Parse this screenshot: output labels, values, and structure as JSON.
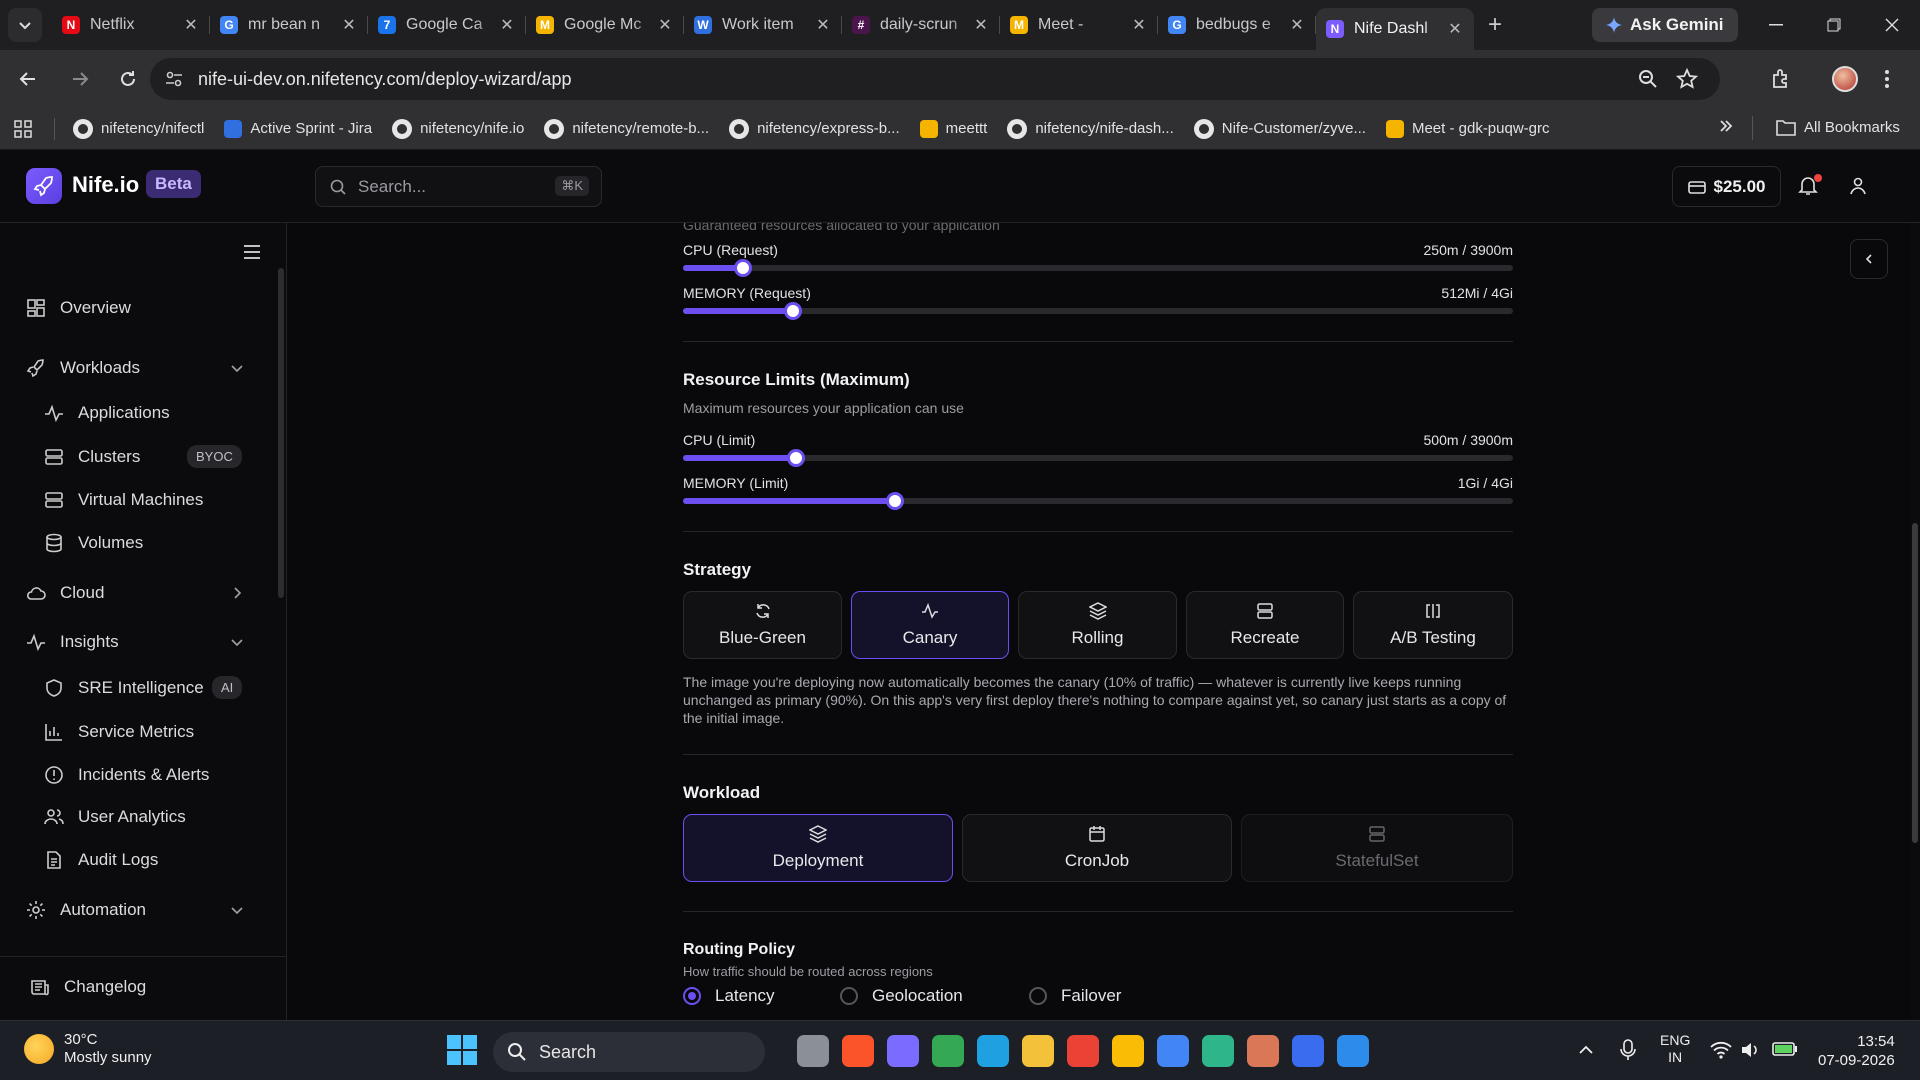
{
  "browser": {
    "tabs": [
      {
        "title": "Netflix",
        "favicon": "netflix-icon",
        "color": "#e50914",
        "glyph": "N"
      },
      {
        "title": "mr bean n",
        "favicon": "google-icon",
        "color": "#4285f4",
        "glyph": "G"
      },
      {
        "title": "Google Ca",
        "favicon": "google-calendar-icon",
        "color": "#1a73e8",
        "glyph": "7"
      },
      {
        "title": "Google Mc",
        "favicon": "google-meet-icon",
        "color": "#f4b400",
        "glyph": "M"
      },
      {
        "title": "Work item",
        "favicon": "azure-devops-icon",
        "color": "#2f6fe0",
        "glyph": "W"
      },
      {
        "title": "daily-scrun",
        "favicon": "slack-icon",
        "color": "#4a154b",
        "glyph": "#"
      },
      {
        "title": "Meet -",
        "favicon": "google-meet-icon",
        "color": "#f4b400",
        "glyph": "M"
      },
      {
        "title": "bedbugs e",
        "favicon": "google-icon",
        "color": "#4285f4",
        "glyph": "G"
      },
      {
        "title": "Nife Dashl",
        "favicon": "nife-icon",
        "color": "#7c5cff",
        "glyph": "N"
      }
    ],
    "gemini_label": "Ask Gemini",
    "url": "nife-ui-dev.on.nifetency.com/deploy-wizard/app",
    "bookmarks": [
      {
        "label": "nifetency/nifectl",
        "icon": "github-icon"
      },
      {
        "label": "Active Sprint - Jira",
        "icon": "jira-icon"
      },
      {
        "label": "nifetency/nife.io",
        "icon": "github-icon"
      },
      {
        "label": "nifetency/remote-b...",
        "icon": "github-icon"
      },
      {
        "label": "nifetency/express-b...",
        "icon": "github-icon"
      },
      {
        "label": "meettt",
        "icon": "google-meet-icon"
      },
      {
        "label": "nifetency/nife-dash...",
        "icon": "github-icon"
      },
      {
        "label": "Nife-Customer/zyve...",
        "icon": "github-icon"
      },
      {
        "label": "Meet - gdk-puqw-grc",
        "icon": "google-meet-icon"
      }
    ],
    "all_bookmarks_label": "All Bookmarks"
  },
  "app": {
    "brand": "Nife.io",
    "beta": "Beta",
    "search_placeholder": "Search...",
    "search_shortcut": "⌘K",
    "balance": "$25.00",
    "accent": "#6d4ef0"
  },
  "sidebar": {
    "overview": "Overview",
    "workloads": "Workloads",
    "applications": "Applications",
    "clusters": "Clusters",
    "clusters_badge": "BYOC",
    "virtual_machines": "Virtual Machines",
    "volumes": "Volumes",
    "cloud": "Cloud",
    "insights": "Insights",
    "sre": "SRE Intelligence",
    "sre_badge": "AI",
    "service_metrics": "Service Metrics",
    "incidents": "Incidents & Alerts",
    "user_analytics": "User Analytics",
    "audit_logs": "Audit Logs",
    "automation": "Automation",
    "changelog": "Changelog"
  },
  "resources": {
    "requests_hint": "Guaranteed resources allocated to your application",
    "cpu_request": {
      "label": "CPU (Request)",
      "value": "250m / 3900m",
      "fraction": 0.0725
    },
    "memory_request": {
      "label": "MEMORY (Request)",
      "value": "512Mi / 4Gi",
      "fraction": 0.133
    },
    "limits_title": "Resource Limits (Maximum)",
    "limits_desc": "Maximum resources your application can use",
    "cpu_limit": {
      "label": "CPU (Limit)",
      "value": "500m / 3900m",
      "fraction": 0.136
    },
    "memory_limit": {
      "label": "MEMORY (Limit)",
      "value": "1Gi / 4Gi",
      "fraction": 0.255
    }
  },
  "strategy": {
    "title": "Strategy",
    "options": [
      "Blue-Green",
      "Canary",
      "Rolling",
      "Recreate",
      "A/B Testing"
    ],
    "selected": "Canary",
    "description": "The image you're deploying now automatically becomes the canary (10% of traffic) — whatever is currently live keeps running unchanged as primary (90%). On this app's very first deploy there's nothing to compare against yet, so canary just starts as a copy of the initial image."
  },
  "workload": {
    "title": "Workload",
    "options": [
      "Deployment",
      "CronJob",
      "StatefulSet"
    ],
    "selected": "Deployment"
  },
  "routing": {
    "title": "Routing Policy",
    "desc": "How traffic should be routed across regions",
    "options": [
      "Latency",
      "Geolocation",
      "Failover"
    ],
    "selected": "Latency"
  },
  "taskbar": {
    "temp": "30°C",
    "condition": "Mostly sunny",
    "search": "Search",
    "lang1": "ENG",
    "lang2": "IN",
    "time": "13:54",
    "date": "07-09-2026"
  }
}
